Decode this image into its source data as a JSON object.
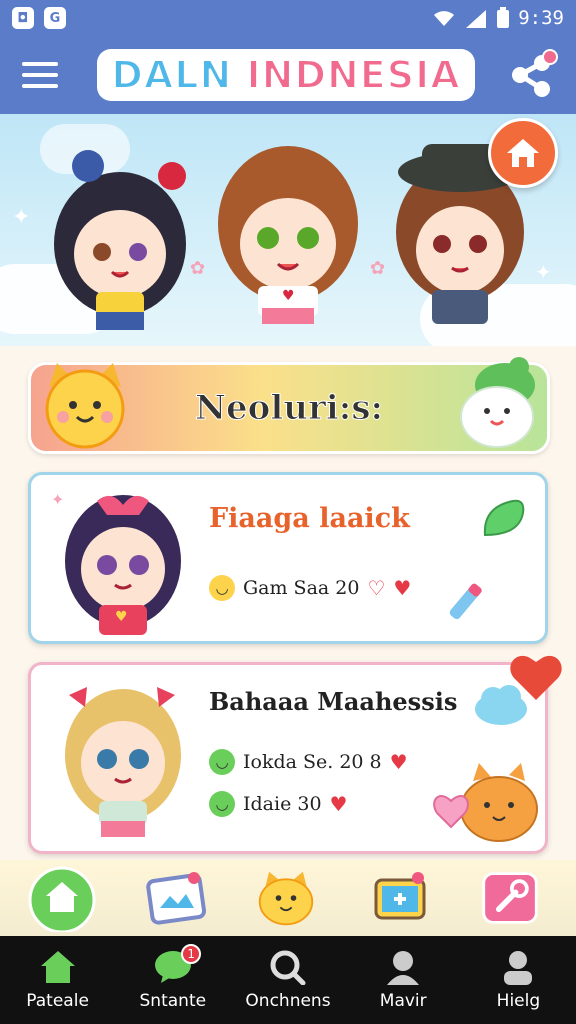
{
  "status_bar": {
    "time": "9:39",
    "icons": [
      "wifi-icon",
      "signal-icon",
      "battery-icon"
    ]
  },
  "app_bar": {
    "title_part1": "DALN",
    "title_part2": " INDNESIA"
  },
  "section": {
    "title": "Neoluri:s:"
  },
  "cards": [
    {
      "name": "Fiaaga laaick",
      "meta": [
        {
          "text": "Gam Saa 20"
        }
      ],
      "accent": "#e8622c"
    },
    {
      "name": "Bahaaa Maahessis",
      "meta": [
        {
          "text": "Iokda Se. 20 8"
        },
        {
          "text": "Idaie 30"
        }
      ]
    }
  ],
  "nav": [
    {
      "label": "Pateale",
      "icon": "home-icon"
    },
    {
      "label": "Sntante",
      "icon": "chat-icon",
      "badge": "1"
    },
    {
      "label": "Onchnens",
      "icon": "search-icon"
    },
    {
      "label": "Mavir",
      "icon": "person-icon"
    },
    {
      "label": "Hielg",
      "icon": "profile-icon"
    }
  ],
  "colors": {
    "header": "#5b7dc9",
    "accent": "#f26b3a",
    "nav": "#111111"
  }
}
